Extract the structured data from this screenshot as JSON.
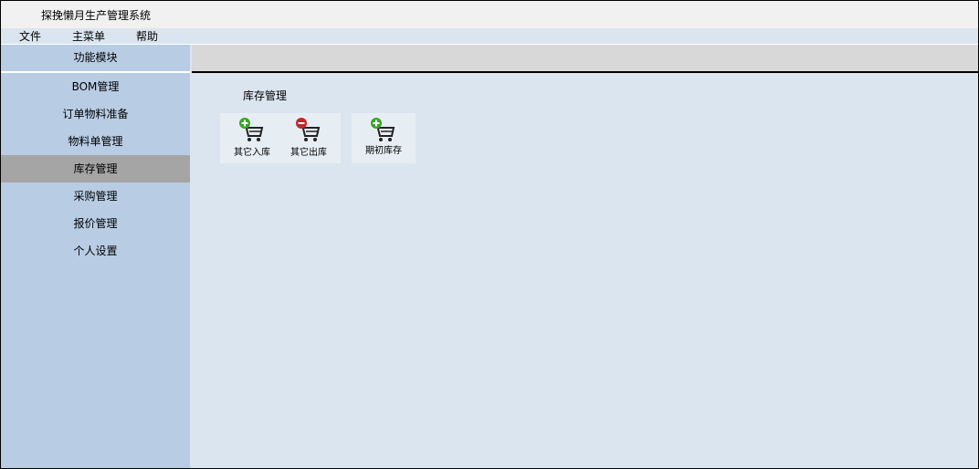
{
  "app": {
    "title": "探挽懒月生产管理系统"
  },
  "menu": {
    "items": [
      "文件",
      "主菜单",
      "帮助"
    ]
  },
  "sidebar": {
    "header": "功能模块",
    "items": [
      {
        "label": "BOM管理"
      },
      {
        "label": "订单物料准备"
      },
      {
        "label": "物料单管理"
      },
      {
        "label": "库存管理",
        "active": true
      },
      {
        "label": "采购管理"
      },
      {
        "label": "报价管理"
      },
      {
        "label": "个人设置"
      }
    ]
  },
  "main": {
    "section_title": "库存管理",
    "tiles": [
      {
        "label": "其它入库",
        "icon": "cart-add-icon"
      },
      {
        "label": "其它出库",
        "icon": "cart-remove-icon"
      },
      {
        "label": "期初库存",
        "icon": "cart-add-icon"
      }
    ]
  },
  "colors": {
    "sidebar": "#b8cde4",
    "active": "#a5a5a5",
    "content": "#dbe5f0",
    "add": "#3aa52a",
    "remove": "#c0272d"
  }
}
